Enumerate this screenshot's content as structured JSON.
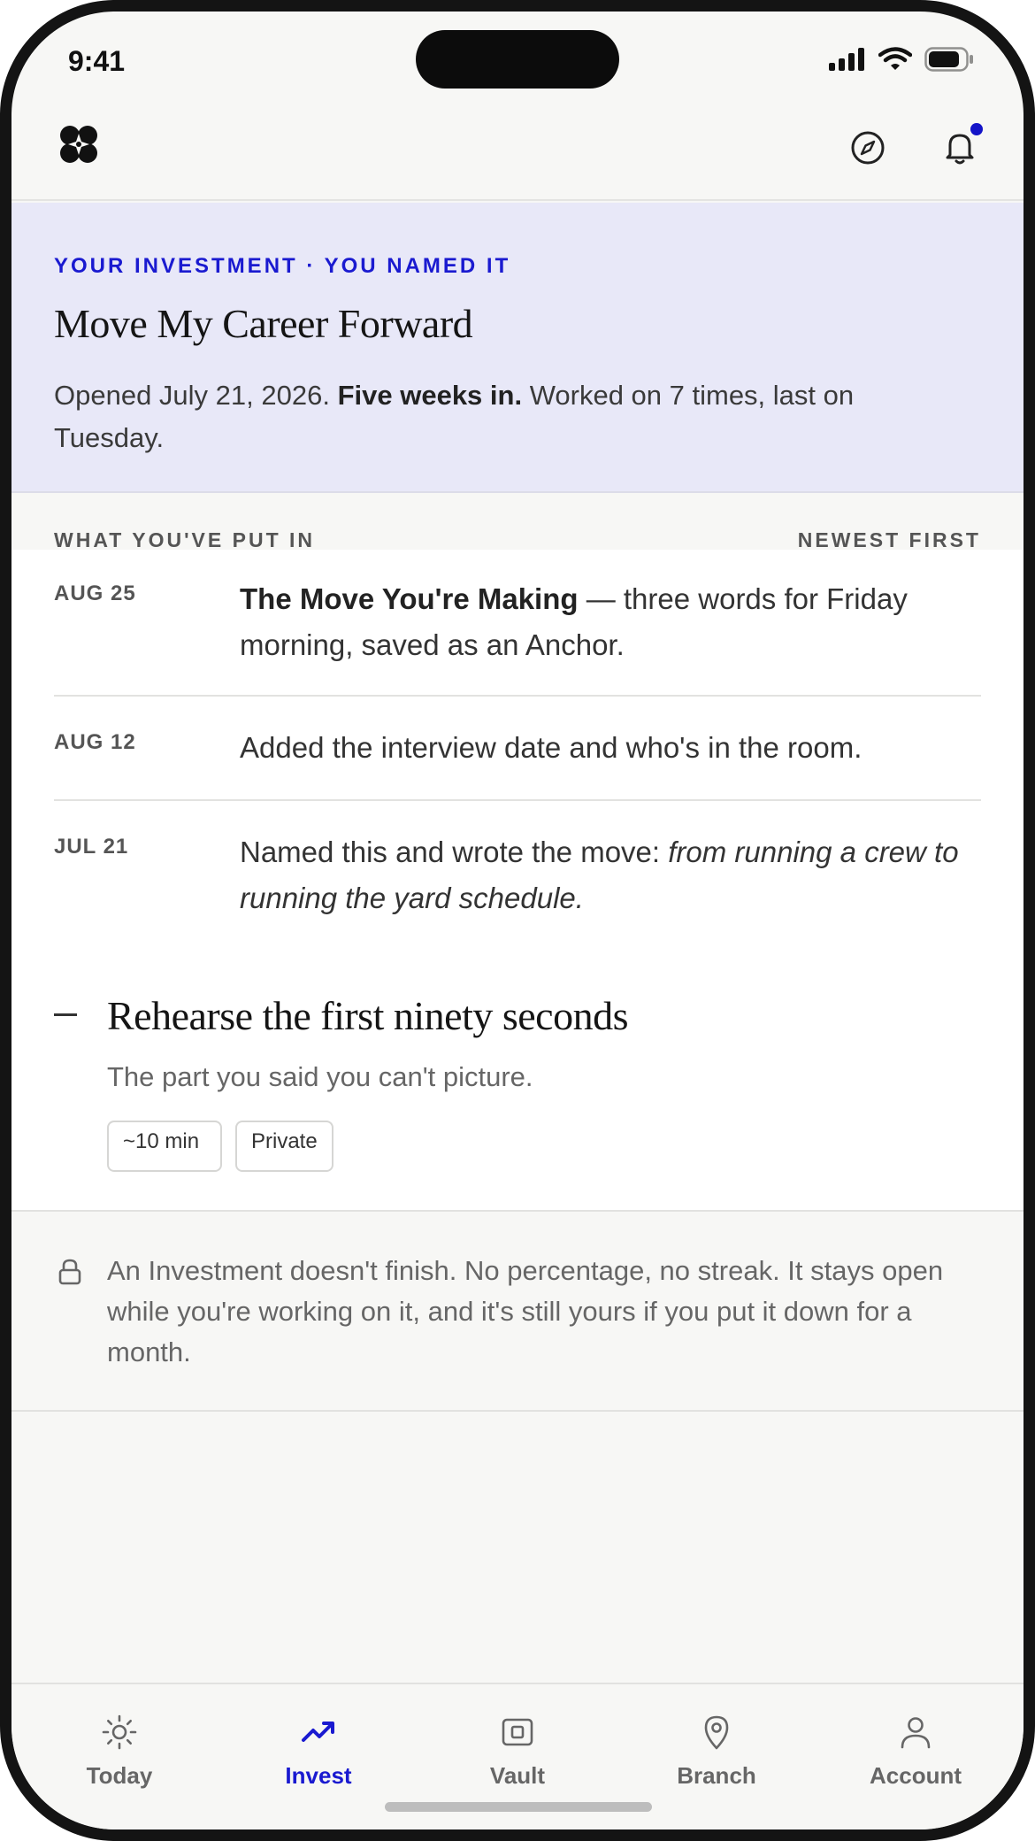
{
  "status_bar": {
    "time": "9:41"
  },
  "colors": {
    "accent": "#1a1ad0",
    "banner_bg": "#e8e8f8",
    "notification_dot": "#1414c8"
  },
  "banner": {
    "eyebrow": "YOUR INVESTMENT · YOU NAMED IT",
    "title": "Move My Career Forward",
    "desc_part1": "Opened July 21, 2026. ",
    "desc_bold": "Five weeks in.",
    "desc_part2": " Worked on 7 times, last on Tuesday."
  },
  "log_section": {
    "label": "WHAT YOU'VE PUT IN",
    "sort": "NEWEST FIRST"
  },
  "log": [
    {
      "date": "AUG 25",
      "bold": "The Move You're Making",
      "text": " — three words for Friday morning, saved as an Anchor."
    },
    {
      "date": "AUG 12",
      "text": "Added the interview date and who's in the room."
    },
    {
      "date": "JUL 21",
      "text": "Named this and wrote the move: ",
      "italic": "from running a crew to running the yard schedule."
    }
  ],
  "suggestion": {
    "title": "Rehearse the first ninety seconds",
    "subtitle": "The part you said you can't picture.",
    "chips": [
      "~10 min",
      "Private"
    ]
  },
  "note": {
    "text": "An Investment doesn't finish. No percentage, no streak. It stays open while you're working on it, and it's still yours if you put it down for a month."
  },
  "tabs": [
    {
      "label": "Today",
      "icon": "sun-icon",
      "active": false
    },
    {
      "label": "Invest",
      "icon": "trending-up-icon",
      "active": true
    },
    {
      "label": "Vault",
      "icon": "vault-icon",
      "active": false
    },
    {
      "label": "Branch",
      "icon": "map-pin-icon",
      "active": false
    },
    {
      "label": "Account",
      "icon": "user-icon",
      "active": false
    }
  ]
}
